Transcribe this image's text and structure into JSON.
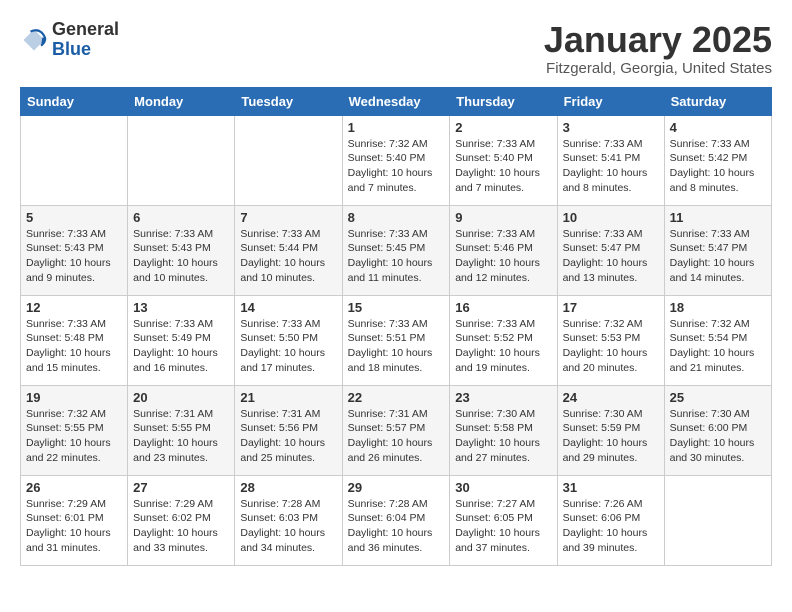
{
  "header": {
    "logo": {
      "general": "General",
      "blue": "Blue"
    },
    "title": "January 2025",
    "location": "Fitzgerald, Georgia, United States"
  },
  "weekdays": [
    "Sunday",
    "Monday",
    "Tuesday",
    "Wednesday",
    "Thursday",
    "Friday",
    "Saturday"
  ],
  "weeks": [
    [
      {
        "day": "",
        "info": ""
      },
      {
        "day": "",
        "info": ""
      },
      {
        "day": "",
        "info": ""
      },
      {
        "day": "1",
        "info": "Sunrise: 7:32 AM\nSunset: 5:40 PM\nDaylight: 10 hours\nand 7 minutes."
      },
      {
        "day": "2",
        "info": "Sunrise: 7:33 AM\nSunset: 5:40 PM\nDaylight: 10 hours\nand 7 minutes."
      },
      {
        "day": "3",
        "info": "Sunrise: 7:33 AM\nSunset: 5:41 PM\nDaylight: 10 hours\nand 8 minutes."
      },
      {
        "day": "4",
        "info": "Sunrise: 7:33 AM\nSunset: 5:42 PM\nDaylight: 10 hours\nand 8 minutes."
      }
    ],
    [
      {
        "day": "5",
        "info": "Sunrise: 7:33 AM\nSunset: 5:43 PM\nDaylight: 10 hours\nand 9 minutes."
      },
      {
        "day": "6",
        "info": "Sunrise: 7:33 AM\nSunset: 5:43 PM\nDaylight: 10 hours\nand 10 minutes."
      },
      {
        "day": "7",
        "info": "Sunrise: 7:33 AM\nSunset: 5:44 PM\nDaylight: 10 hours\nand 10 minutes."
      },
      {
        "day": "8",
        "info": "Sunrise: 7:33 AM\nSunset: 5:45 PM\nDaylight: 10 hours\nand 11 minutes."
      },
      {
        "day": "9",
        "info": "Sunrise: 7:33 AM\nSunset: 5:46 PM\nDaylight: 10 hours\nand 12 minutes."
      },
      {
        "day": "10",
        "info": "Sunrise: 7:33 AM\nSunset: 5:47 PM\nDaylight: 10 hours\nand 13 minutes."
      },
      {
        "day": "11",
        "info": "Sunrise: 7:33 AM\nSunset: 5:47 PM\nDaylight: 10 hours\nand 14 minutes."
      }
    ],
    [
      {
        "day": "12",
        "info": "Sunrise: 7:33 AM\nSunset: 5:48 PM\nDaylight: 10 hours\nand 15 minutes."
      },
      {
        "day": "13",
        "info": "Sunrise: 7:33 AM\nSunset: 5:49 PM\nDaylight: 10 hours\nand 16 minutes."
      },
      {
        "day": "14",
        "info": "Sunrise: 7:33 AM\nSunset: 5:50 PM\nDaylight: 10 hours\nand 17 minutes."
      },
      {
        "day": "15",
        "info": "Sunrise: 7:33 AM\nSunset: 5:51 PM\nDaylight: 10 hours\nand 18 minutes."
      },
      {
        "day": "16",
        "info": "Sunrise: 7:33 AM\nSunset: 5:52 PM\nDaylight: 10 hours\nand 19 minutes."
      },
      {
        "day": "17",
        "info": "Sunrise: 7:32 AM\nSunset: 5:53 PM\nDaylight: 10 hours\nand 20 minutes."
      },
      {
        "day": "18",
        "info": "Sunrise: 7:32 AM\nSunset: 5:54 PM\nDaylight: 10 hours\nand 21 minutes."
      }
    ],
    [
      {
        "day": "19",
        "info": "Sunrise: 7:32 AM\nSunset: 5:55 PM\nDaylight: 10 hours\nand 22 minutes."
      },
      {
        "day": "20",
        "info": "Sunrise: 7:31 AM\nSunset: 5:55 PM\nDaylight: 10 hours\nand 23 minutes."
      },
      {
        "day": "21",
        "info": "Sunrise: 7:31 AM\nSunset: 5:56 PM\nDaylight: 10 hours\nand 25 minutes."
      },
      {
        "day": "22",
        "info": "Sunrise: 7:31 AM\nSunset: 5:57 PM\nDaylight: 10 hours\nand 26 minutes."
      },
      {
        "day": "23",
        "info": "Sunrise: 7:30 AM\nSunset: 5:58 PM\nDaylight: 10 hours\nand 27 minutes."
      },
      {
        "day": "24",
        "info": "Sunrise: 7:30 AM\nSunset: 5:59 PM\nDaylight: 10 hours\nand 29 minutes."
      },
      {
        "day": "25",
        "info": "Sunrise: 7:30 AM\nSunset: 6:00 PM\nDaylight: 10 hours\nand 30 minutes."
      }
    ],
    [
      {
        "day": "26",
        "info": "Sunrise: 7:29 AM\nSunset: 6:01 PM\nDaylight: 10 hours\nand 31 minutes."
      },
      {
        "day": "27",
        "info": "Sunrise: 7:29 AM\nSunset: 6:02 PM\nDaylight: 10 hours\nand 33 minutes."
      },
      {
        "day": "28",
        "info": "Sunrise: 7:28 AM\nSunset: 6:03 PM\nDaylight: 10 hours\nand 34 minutes."
      },
      {
        "day": "29",
        "info": "Sunrise: 7:28 AM\nSunset: 6:04 PM\nDaylight: 10 hours\nand 36 minutes."
      },
      {
        "day": "30",
        "info": "Sunrise: 7:27 AM\nSunset: 6:05 PM\nDaylight: 10 hours\nand 37 minutes."
      },
      {
        "day": "31",
        "info": "Sunrise: 7:26 AM\nSunset: 6:06 PM\nDaylight: 10 hours\nand 39 minutes."
      },
      {
        "day": "",
        "info": ""
      }
    ]
  ]
}
